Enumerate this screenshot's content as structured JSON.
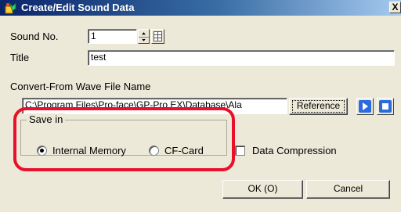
{
  "window": {
    "title": "Create/Edit Sound Data",
    "close_glyph": "X"
  },
  "sound_no": {
    "label": "Sound No.",
    "value": "1"
  },
  "title_field": {
    "label": "Title",
    "value": "test"
  },
  "wave_file": {
    "label": "Convert-From Wave File Name",
    "value": "C:\\Program Files\\Pro-face\\GP-Pro EX\\Database\\Ala",
    "reference_label": "Reference"
  },
  "save_in": {
    "group_label": "Save in",
    "options": [
      {
        "label": "Internal Memory",
        "selected": true
      },
      {
        "label": "CF-Card",
        "selected": false
      }
    ]
  },
  "data_compression": {
    "label": "Data Compression",
    "checked": false
  },
  "buttons": {
    "ok": "OK (O)",
    "cancel": "Cancel"
  },
  "icons": {
    "app": "sound-data-icon",
    "play": "play-icon",
    "stop": "stop-icon",
    "spinner_table": "table-grid-icon"
  },
  "colors": {
    "title_bar_start": "#0a246a",
    "title_bar_end": "#a6caf0",
    "highlight": "#e8102b",
    "dialog_bg": "#ece9d8",
    "play_blue": "#2a6be0"
  }
}
